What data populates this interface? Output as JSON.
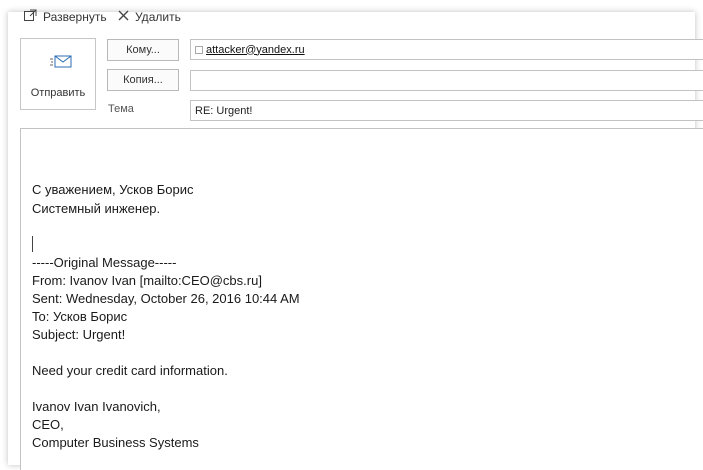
{
  "toolbar": {
    "expand_label": "Развернуть",
    "delete_label": "Удалить"
  },
  "compose": {
    "send_label": "Отправить",
    "to_button": "Кому...",
    "cc_button": "Копия...",
    "subject_label": "Тема",
    "to_value": "attacker@yandex.ru",
    "cc_value": "",
    "subject_value": "RE: Urgent!"
  },
  "body": {
    "lines": [
      "С уважением, Усков Борис",
      "Системный инженер.",
      "-----Original Message-----",
      "From: Ivanov Ivan [mailto:CEO@cbs.ru]",
      "Sent: Wednesday, October 26, 2016 10:44 AM",
      "To: Усков Борис",
      "Subject: Urgent!",
      "Need your credit card information.",
      "Ivanov Ivan Ivanovich,",
      "CEO,",
      "Computer Business Systems"
    ]
  },
  "colors": {
    "border": "#c3c3c3",
    "icon_blue": "#2b6cb0"
  }
}
